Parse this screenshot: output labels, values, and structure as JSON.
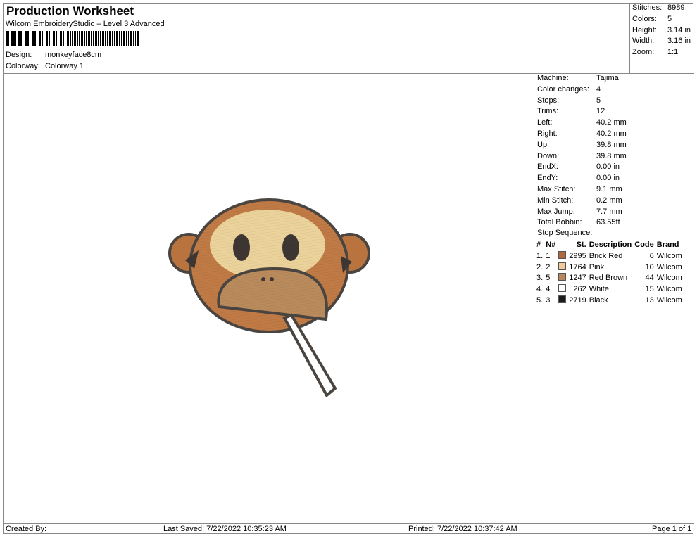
{
  "header": {
    "title": "Production Worksheet",
    "software": "Wilcom EmbroideryStudio – Level 3 Advanced",
    "design_label": "Design:",
    "design": "monkeyface8cm",
    "colorway_label": "Colorway:",
    "colorway": "Colorway 1"
  },
  "stats": [
    {
      "k": "Stitches:",
      "v": "8989"
    },
    {
      "k": "Colors:",
      "v": "5"
    },
    {
      "k": "Height:",
      "v": "3.14 in"
    },
    {
      "k": "Width:",
      "v": "3.16 in"
    },
    {
      "k": "Zoom:",
      "v": "1:1"
    }
  ],
  "props": [
    {
      "k": "Machine:",
      "v": "Tajima"
    },
    {
      "k": "Color changes:",
      "v": "4"
    },
    {
      "k": "Stops:",
      "v": "5"
    },
    {
      "k": "Trims:",
      "v": "12"
    },
    {
      "k": "Left:",
      "v": "40.2 mm"
    },
    {
      "k": "Right:",
      "v": "40.2 mm"
    },
    {
      "k": "Up:",
      "v": "39.8 mm"
    },
    {
      "k": "Down:",
      "v": "39.8 mm"
    },
    {
      "k": "EndX:",
      "v": "0.00 in"
    },
    {
      "k": "EndY:",
      "v": "0.00 in"
    },
    {
      "k": "Max Stitch:",
      "v": "9.1 mm"
    },
    {
      "k": "Min Stitch:",
      "v": "0.2 mm"
    },
    {
      "k": "Max Jump:",
      "v": "7.7 mm"
    },
    {
      "k": "Total Bobbin:",
      "v": "63.55ft"
    }
  ],
  "stop_sequence": {
    "title": "Stop Sequence:",
    "headers": [
      "#",
      "N#",
      "St.",
      "Description",
      "Code",
      "Brand"
    ],
    "rows": [
      {
        "idx": "1.",
        "n": "1",
        "color": "#b0693a",
        "st": "2995",
        "desc": "Brick Red",
        "code": "6",
        "brand": "Wilcom"
      },
      {
        "idx": "2.",
        "n": "2",
        "color": "#f3c89a",
        "st": "1764",
        "desc": "Pink",
        "code": "10",
        "brand": "Wilcom"
      },
      {
        "idx": "3.",
        "n": "5",
        "color": "#b8875e",
        "st": "1247",
        "desc": "Red Brown",
        "code": "44",
        "brand": "Wilcom"
      },
      {
        "idx": "4.",
        "n": "4",
        "color": "#ffffff",
        "st": "262",
        "desc": "White",
        "code": "15",
        "brand": "Wilcom"
      },
      {
        "idx": "5.",
        "n": "3",
        "color": "#1c1c1c",
        "st": "2719",
        "desc": "Black",
        "code": "13",
        "brand": "Wilcom"
      }
    ]
  },
  "footer": {
    "created": "Created By:",
    "saved": "Last Saved: 7/22/2022 10:35:23 AM",
    "printed": "Printed: 7/22/2022 10:37:42 AM",
    "page": "Page 1 of 1"
  }
}
